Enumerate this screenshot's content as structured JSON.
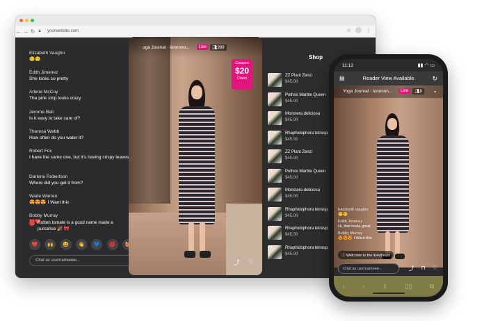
{
  "browser": {
    "url": "yourwebsite.com",
    "icons": {
      "back": "arrow-left-icon",
      "forward": "arrow-right-icon",
      "reload": "reload-icon",
      "lock": "lock-icon",
      "star": "star-icon",
      "menu": "kebab-menu-icon"
    }
  },
  "chat": {
    "messages": [
      {
        "name": "Elizabeth Vaughn",
        "text": "😊😊"
      },
      {
        "name": "Edith Jimenez",
        "text": "She looks so pretty"
      },
      {
        "name": "Arlene McCoy",
        "text": "The pink strip looks crazy"
      },
      {
        "name": "Jerome Bell",
        "text": "Is it easy to take care of?"
      },
      {
        "name": "Theresa Webb",
        "text": "How often do you water it?"
      },
      {
        "name": "Robert Fox",
        "text": "I have the same one, but it's having crispy leaves"
      },
      {
        "name": "Darlene Robertson",
        "text": "Where did you get it from?"
      },
      {
        "name": "Wade Warren",
        "text": "😍😍😍 I Want this"
      },
      {
        "name": "Bobby Murray",
        "text": "❤️❤️"
      }
    ],
    "pinned_message": "Rotten tomate is a good name made a purcahse 🎉 🎀",
    "emojis": [
      "❤️",
      "🙌",
      "😀",
      "👋",
      "💙",
      "💋",
      "😻"
    ],
    "input_placeholder": "Chat as usernameeee..."
  },
  "video": {
    "title": "oga Journal · Ionnnnn...",
    "live_label": "Live",
    "viewers": "999",
    "coupon": {
      "label": "Coupon",
      "amount": "$20",
      "claim": "Claim"
    },
    "icons": {
      "share": "share-icon",
      "like": "heart-icon"
    }
  },
  "shop": {
    "title": "Shop",
    "items": [
      {
        "name": "ZZ Plant Zenzi",
        "price": "$45.00"
      },
      {
        "name": "Pothos Marble Queen",
        "price": "$45.00"
      },
      {
        "name": "Monstera deliciosa",
        "price": "$45.00"
      },
      {
        "name": "Rhaphidophora tetrasp...",
        "price": "$45.00"
      },
      {
        "name": "ZZ Plant Zenzi",
        "price": "$45.00"
      },
      {
        "name": "Pothos Marble Queen",
        "price": "$45.00"
      },
      {
        "name": "Monstera deliciosa",
        "price": "$45.00"
      },
      {
        "name": "Rhaphidophora tetrasp...",
        "price": "$45.00"
      },
      {
        "name": "Rhaphidophora tetrasp...",
        "price": "$45.00"
      },
      {
        "name": "Rhaphidophora tetrasp...",
        "price": "$45.00"
      }
    ]
  },
  "phone": {
    "time": "11:12",
    "reader_view": "Reader View Available",
    "title": "Yoga Journal · Ionnnnn...",
    "live_label": "Live",
    "viewers": "8",
    "chat": [
      {
        "name": "Elizabeth Vaughn",
        "text": "😊😊"
      },
      {
        "name": "Edith Jimenez",
        "text": "Hi, that looks great"
      },
      {
        "name": "Bobby Murray",
        "text": "😍😍😍 I Want this"
      }
    ],
    "welcome": "Welcome to the livestream",
    "input_placeholder": "Chat as usernameee..."
  }
}
